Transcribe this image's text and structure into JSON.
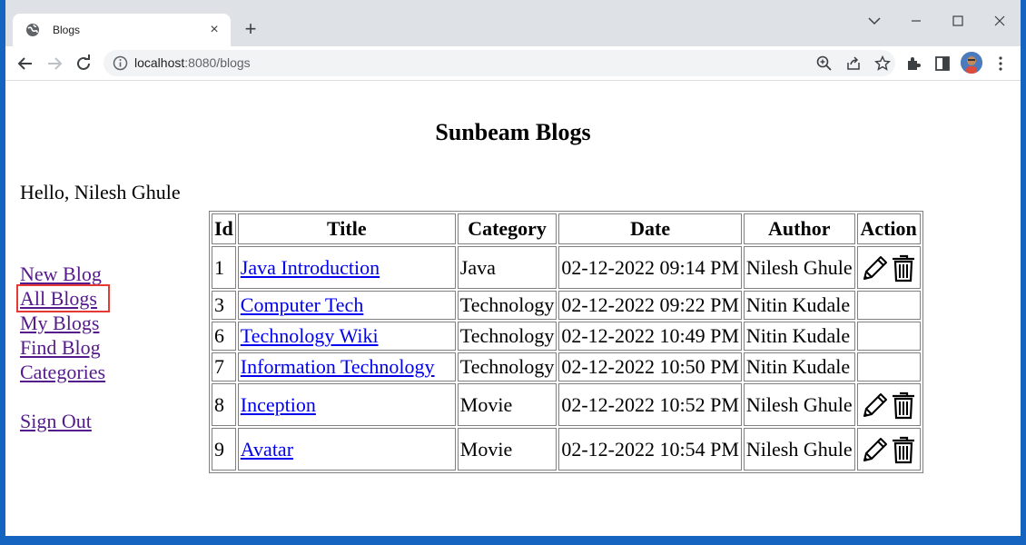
{
  "browser": {
    "tab_title": "Blogs",
    "tab_close": "×",
    "new_tab": "+",
    "url_host": "localhost",
    "url_rest": ":8080/blogs"
  },
  "page": {
    "title": "Sunbeam Blogs",
    "greeting": "Hello, Nilesh Ghule"
  },
  "sidebar": {
    "items": [
      {
        "label": "New Blog"
      },
      {
        "label": "All Blogs"
      },
      {
        "label": "My Blogs"
      },
      {
        "label": "Find Blog"
      },
      {
        "label": "Categories"
      },
      {
        "label": "Sign Out"
      }
    ],
    "active": "All Blogs",
    "active_outline_color": "#e53935"
  },
  "table": {
    "headers": [
      "Id",
      "Title",
      "Category",
      "Date",
      "Author",
      "Action"
    ],
    "rows": [
      {
        "id": "1",
        "title": "Java Introduction",
        "category": "Java",
        "date": "02-12-2022 09:14 PM",
        "author": "Nilesh Ghule",
        "actions": [
          "edit-icon",
          "trash-icon"
        ]
      },
      {
        "id": "3",
        "title": "Computer Tech",
        "category": "Technology",
        "date": "02-12-2022 09:22 PM",
        "author": "Nitin Kudale",
        "actions": []
      },
      {
        "id": "6",
        "title": "Technology Wiki",
        "category": "Technology",
        "date": "02-12-2022 10:49 PM",
        "author": "Nitin Kudale",
        "actions": []
      },
      {
        "id": "7",
        "title": "Information Technology",
        "category": "Technology",
        "date": "02-12-2022 10:50 PM",
        "author": "Nitin Kudale",
        "actions": []
      },
      {
        "id": "8",
        "title": "Inception",
        "category": "Movie",
        "date": "02-12-2022 10:52 PM",
        "author": "Nilesh Ghule",
        "actions": [
          "edit-icon",
          "trash-icon"
        ]
      },
      {
        "id": "9",
        "title": "Avatar",
        "category": "Movie",
        "date": "02-12-2022 10:54 PM",
        "author": "Nilesh Ghule",
        "actions": [
          "edit-icon",
          "trash-icon"
        ]
      }
    ]
  },
  "colors": {
    "desktop": "#1565c0",
    "link": "#0000ee",
    "visited_link": "#551a8b"
  }
}
